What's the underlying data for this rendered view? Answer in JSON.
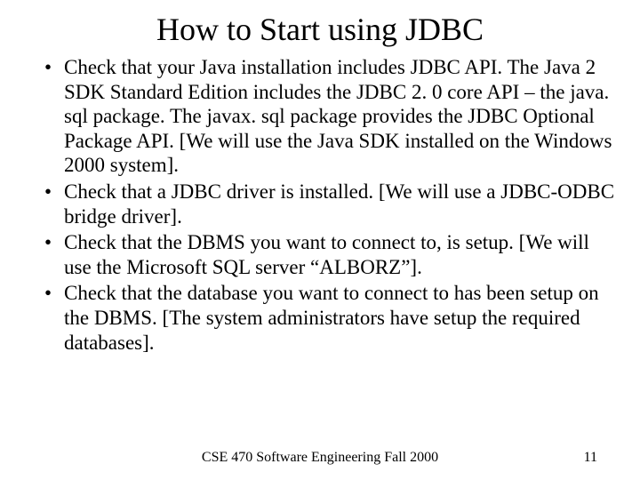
{
  "title": "How to Start using JDBC",
  "bullets": [
    "Check that your Java installation includes JDBC API. The Java 2 SDK Standard Edition includes the JDBC 2. 0 core API – the java. sql package.  The javax. sql package provides the JDBC Optional Package API. [We will use the Java SDK installed on the Windows 2000 system].",
    "Check that a JDBC driver is installed.  [We will use a JDBC-ODBC bridge driver].",
    "Check that the DBMS you want to connect to, is setup. [We will use the Microsoft SQL server “ALBORZ”].",
    "Check that the database you want to connect to has been setup on the DBMS. [The system administrators have setup the required databases]."
  ],
  "footer": {
    "center": "CSE 470    Software Engineering     Fall 2000",
    "page": "11"
  }
}
